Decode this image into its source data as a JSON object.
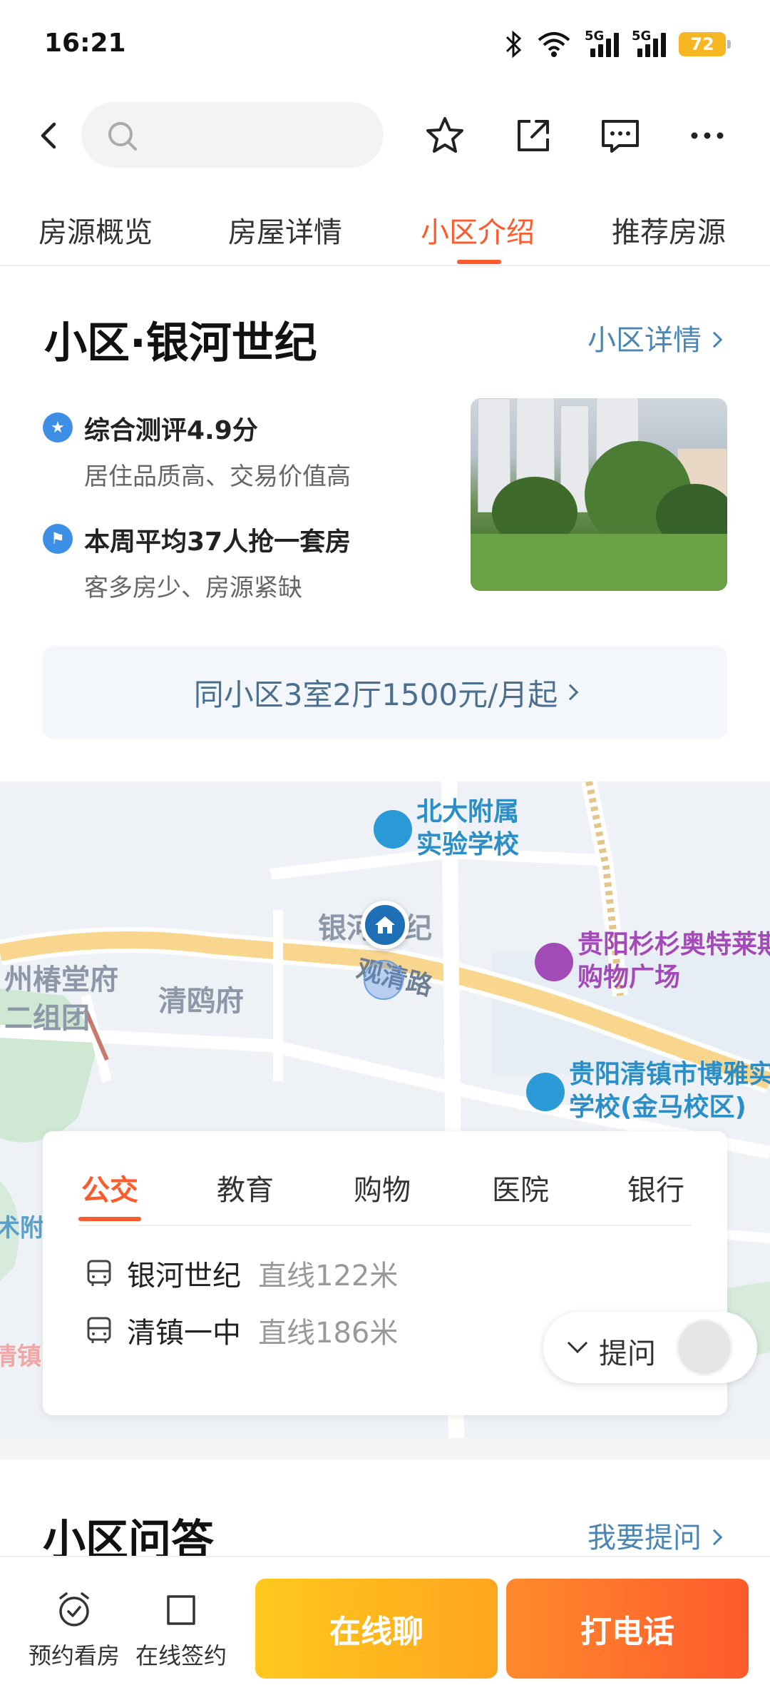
{
  "status_bar": {
    "time": "16:21",
    "network_label": "5G",
    "battery": "72"
  },
  "nav": {
    "search_placeholder": ""
  },
  "tabs": [
    {
      "label": "房源概览"
    },
    {
      "label": "房屋详情"
    },
    {
      "label": "小区介绍"
    },
    {
      "label": "推荐房源"
    }
  ],
  "community": {
    "title": "小区·银河世纪",
    "detail_link": "小区详情",
    "features": [
      {
        "title": "综合测评4.9分",
        "subtitle": "居住品质高、交易价值高"
      },
      {
        "title": "本周平均37人抢一套房",
        "subtitle": "客多房少、房源紧缺"
      }
    ],
    "promo": "同小区3室2厅1500元/月起"
  },
  "map": {
    "pois": [
      {
        "line1": "北大附属",
        "line2": "实验学校"
      },
      {
        "line1": "贵阳杉杉奥特莱斯",
        "line2": "购物广场"
      },
      {
        "line1": "贵阳清镇市博雅实",
        "line2": "学校(金马校区)"
      }
    ],
    "places": {
      "community": "银河世纪",
      "road": "观清路",
      "west1": "州椿堂府",
      "west2": "二组团",
      "qingoufu": "清鸥府",
      "edge_left": "术附",
      "edge_bottom": "清镇"
    }
  },
  "nearby": {
    "tabs": [
      "公交",
      "教育",
      "购物",
      "医院",
      "银行"
    ],
    "stops": [
      {
        "name": "银河世纪",
        "distance": "直线122米"
      },
      {
        "name": "清镇一中",
        "distance": "直线186米"
      }
    ],
    "ask_label": "提问"
  },
  "qa": {
    "title": "小区问答",
    "link": "我要提问"
  },
  "bottom_bar": {
    "viewing": "预约看房",
    "sign": "在线签约",
    "chat": "在线聊",
    "call": "打电话"
  },
  "colors": {
    "accent": "#ff5a2c",
    "link": "#4a86b4",
    "chat_button": "#ffb31f",
    "call_button": "#ff6a2c"
  }
}
